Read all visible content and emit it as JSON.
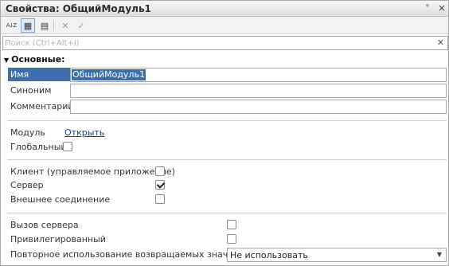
{
  "window": {
    "title": "Свойства: ОбщийМодуль1",
    "pin_glyph": "ᵠ",
    "close_glyph": "×"
  },
  "toolbar": {
    "sort_glyph": "A↓Z",
    "categories_glyph": "▦",
    "filter_glyph": "▤",
    "cancel_glyph": "✕",
    "apply_glyph": "✓"
  },
  "search": {
    "placeholder": "Поиск (Ctrl+Alt+I)",
    "value": "",
    "clear_glyph": "✕"
  },
  "section": {
    "arrow": "▼",
    "title": "Основные:"
  },
  "props": {
    "name_label": "Имя",
    "name_value": "ОбщийМодуль1",
    "synonym_label": "Синоним",
    "synonym_value": "",
    "comment_label": "Комментарий",
    "comment_value": "",
    "module_label": "Модуль",
    "module_link": "Открыть",
    "global_label": "Глобальный",
    "global_checked": false,
    "client_label": "Клиент (управляемое приложение)",
    "client_checked": false,
    "server_label": "Сервер",
    "server_checked": true,
    "external_label": "Внешнее соединение",
    "external_checked": false,
    "server_call_label": "Вызов сервера",
    "server_call_checked": false,
    "privileged_label": "Привилегированный",
    "privileged_checked": false,
    "reuse_label": "Повторное использование возвращаемых значений",
    "reuse_value": "Не использовать",
    "dropdown_glyph": "▼"
  }
}
